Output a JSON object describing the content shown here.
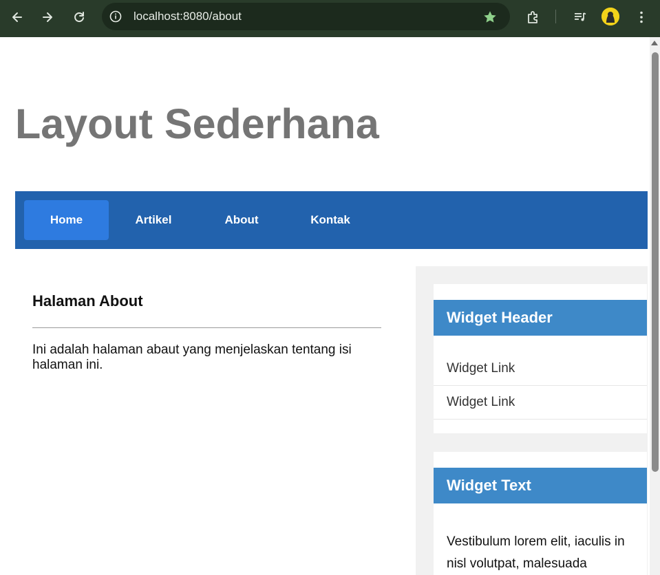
{
  "browser": {
    "url": "localhost:8080/about",
    "icons": {
      "back": "arrow-left-icon",
      "forward": "arrow-right-icon",
      "reload": "reload-icon",
      "site_info": "info-icon",
      "bookmark": "star-icon",
      "extensions": "puzzle-icon",
      "media": "media-list-icon",
      "menu": "more-vert-icon"
    },
    "colors": {
      "toolbar": "#293b2a",
      "bookmark_star": "#8fd18b"
    }
  },
  "page": {
    "site_title": "Layout Sederhana",
    "nav": {
      "items": [
        {
          "label": "Home",
          "active": true
        },
        {
          "label": "Artikel",
          "active": false
        },
        {
          "label": "About",
          "active": false
        },
        {
          "label": "Kontak",
          "active": false
        }
      ],
      "colors": {
        "bar": "#2262ad",
        "active": "#2e7be0"
      }
    },
    "content": {
      "heading": "Halaman About",
      "body": "Ini adalah halaman abaut yang menjelaskan tentang isi halaman ini."
    },
    "sidebar": {
      "widgets": [
        {
          "header": "Widget Header",
          "links": [
            "Widget Link",
            "Widget Link"
          ]
        },
        {
          "header": "Widget Text",
          "text": "Vestibulum lorem elit, iaculis in nisl volutpat, malesuada"
        }
      ],
      "colors": {
        "widget_header": "#3e89c8"
      }
    }
  }
}
